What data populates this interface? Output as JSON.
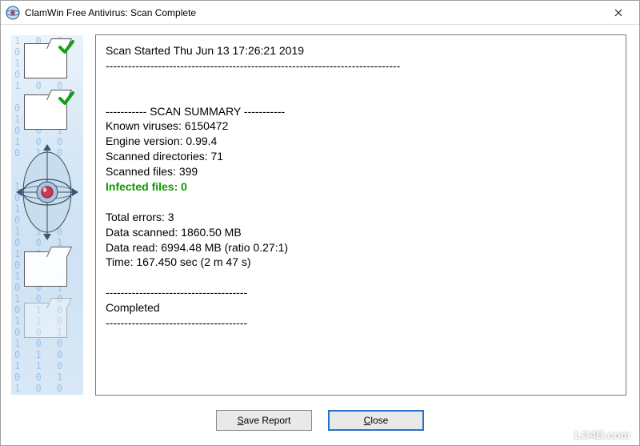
{
  "window": {
    "title": "ClamWin Free Antivirus: Scan Complete"
  },
  "report": {
    "scan_started": "Scan Started Thu Jun 13 17:26:21 2019",
    "sep1": "-------------------------------------------------------------------------------",
    "summary_header": "----------- SCAN SUMMARY -----------",
    "known_viruses": "Known viruses: 6150472",
    "engine_version": "Engine version: 0.99.4",
    "scanned_dirs": "Scanned directories: 71",
    "scanned_files": "Scanned files: 399",
    "infected": "Infected files: 0",
    "total_errors": "Total errors: 3",
    "data_scanned": "Data scanned: 1860.50 MB",
    "data_read": "Data read: 6994.48 MB (ratio 0.27:1)",
    "time": "Time: 167.450 sec (2 m 47 s)",
    "sep2": "--------------------------------------",
    "completed": "Completed",
    "sep3": "--------------------------------------"
  },
  "buttons": {
    "save_mn": "S",
    "save_rest": "ave Report",
    "close_mn": "C",
    "close_rest": "lose"
  },
  "watermark": "LO4D.com"
}
